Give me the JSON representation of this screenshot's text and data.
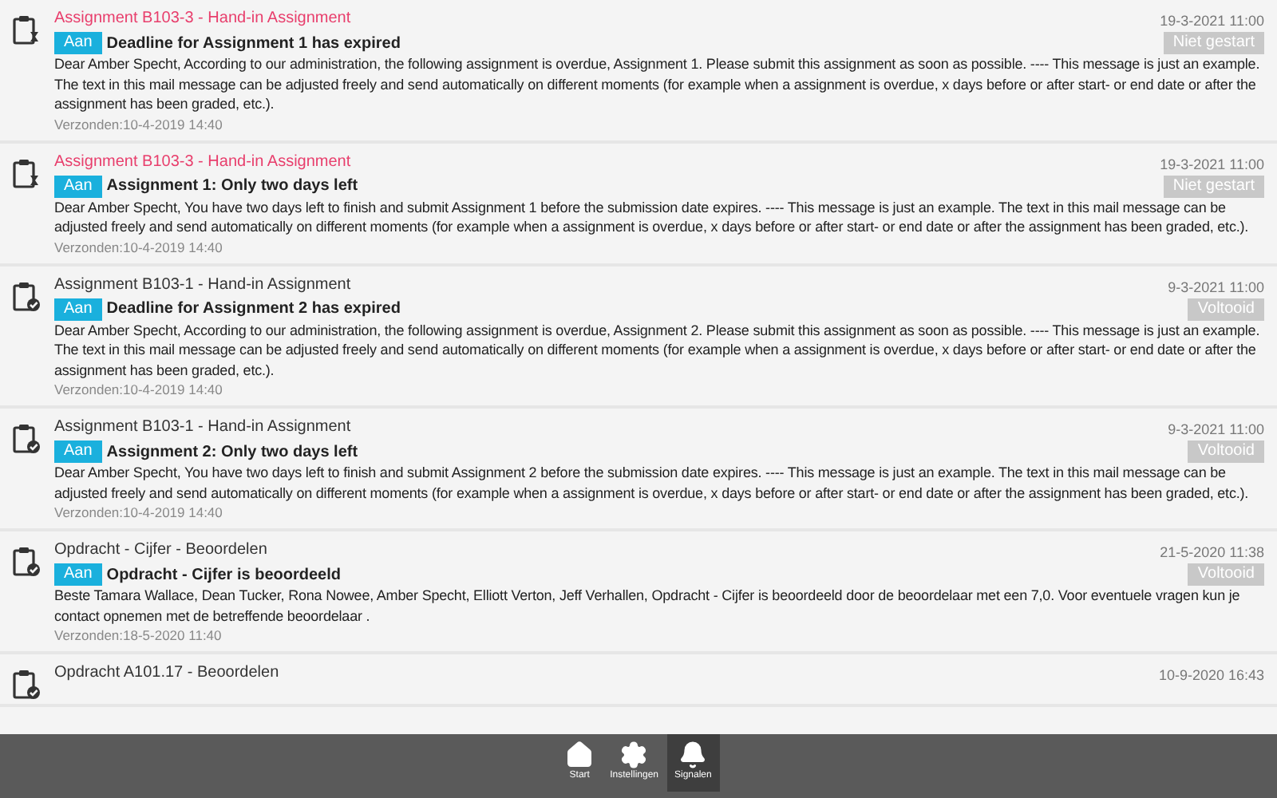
{
  "messages": [
    {
      "kind": "pending",
      "title": "Assignment B103-3 - Hand-in Assignment",
      "date": "19-3-2021 11:00",
      "recipient": "Aan",
      "subject": "Deadline for Assignment 1 has expired",
      "status": "Niet gestart",
      "body": "Dear Amber Specht, According to our administration, the following assignment is overdue, Assignment 1. Please submit this assignment as soon as possible. ---- This message is just an example. The text in this mail message can be adjusted freely and send automatically on different moments (for example when a assignment is overdue, x days before or after start- or end date or after the assignment has been graded, etc.).",
      "sent": "Verzonden:10-4-2019 14:40"
    },
    {
      "kind": "pending",
      "title": "Assignment B103-3 - Hand-in Assignment",
      "date": "19-3-2021 11:00",
      "recipient": "Aan",
      "subject": "Assignment 1: Only two days left",
      "status": "Niet gestart",
      "body": "Dear Amber Specht, You have two days left to finish and submit Assignment 1 before the submission date expires. ---- This message is just an example. The text in this mail message can be adjusted freely and send automatically on different moments (for example when a assignment is overdue, x days before or after start- or end date or after the assignment has been graded, etc.).",
      "sent": "Verzonden:10-4-2019 14:40"
    },
    {
      "kind": "done",
      "title": "Assignment B103-1 - Hand-in Assignment",
      "date": "9-3-2021 11:00",
      "recipient": "Aan",
      "subject": "Deadline for Assignment 2 has expired",
      "status": "Voltooid",
      "body": "Dear Amber Specht, According to our administration, the following assignment is overdue, Assignment 2. Please submit this assignment as soon as possible. ---- This message is just an example. The text in this mail message can be adjusted freely and send automatically on different moments (for example when a assignment is overdue, x days before or after start- or end date or after the assignment has been graded, etc.).",
      "sent": "Verzonden:10-4-2019 14:40"
    },
    {
      "kind": "done",
      "title": "Assignment B103-1 - Hand-in Assignment",
      "date": "9-3-2021 11:00",
      "recipient": "Aan",
      "subject": "Assignment 2: Only two days left",
      "status": "Voltooid",
      "body": "Dear Amber Specht, You have two days left to finish and submit Assignment 2 before the submission date expires. ---- This message is just an example. The text in this mail message can be adjusted freely and send automatically on different moments (for example when a assignment is overdue, x days before or after start- or end date or after the assignment has been graded, etc.).",
      "sent": "Verzonden:10-4-2019 14:40"
    },
    {
      "kind": "done",
      "title": "Opdracht - Cijfer - Beoordelen",
      "date": "21-5-2020 11:38",
      "recipient": "Aan",
      "subject": "Opdracht - Cijfer is beoordeeld",
      "status": "Voltooid",
      "body": "Beste Tamara Wallace, Dean Tucker, Rona Nowee, Amber Specht, Elliott Verton, Jeff Verhallen, Opdracht - Cijfer is beoordeeld door de beoordelaar met een 7,0. Voor eventuele vragen kun je contact opnemen met de betreffende beoordelaar .",
      "sent": "Verzonden:18-5-2020 11:40"
    },
    {
      "kind": "partial",
      "title": "Opdracht A101.17 - Beoordelen",
      "date": "10-9-2020 16:43"
    }
  ],
  "nav": [
    {
      "label": "Start",
      "selected": false
    },
    {
      "label": "Instellingen",
      "selected": false
    },
    {
      "label": "Signalen",
      "selected": true
    }
  ]
}
